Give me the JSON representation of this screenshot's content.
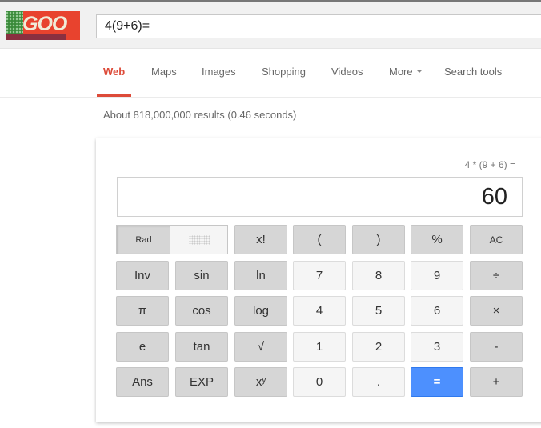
{
  "header": {
    "logo_text": "GOOGLE",
    "search_value": "4(9+6)="
  },
  "nav": {
    "tabs": [
      {
        "label": "Web",
        "active": true
      },
      {
        "label": "Maps"
      },
      {
        "label": "Images"
      },
      {
        "label": "Shopping"
      },
      {
        "label": "Videos"
      },
      {
        "label": "More",
        "dropdown": true
      },
      {
        "label": "Search tools"
      }
    ]
  },
  "stats": "About 818,000,000 results (0.46 seconds)",
  "calculator": {
    "expression": "4 * (9 + 6) =",
    "result": "60",
    "angle_mode": {
      "rad": "Rad",
      "selected": "Rad"
    },
    "rows": [
      [
        {
          "label": "x!",
          "t": "fn"
        },
        {
          "label": "(",
          "t": "fn"
        },
        {
          "label": ")",
          "t": "fn"
        },
        {
          "label": "%",
          "t": "fn"
        },
        {
          "label": "AC",
          "t": "fn small"
        }
      ],
      [
        {
          "label": "Inv",
          "t": "fn"
        },
        {
          "label": "sin",
          "t": "fn"
        },
        {
          "label": "ln",
          "t": "fn"
        },
        {
          "label": "7",
          "t": "num"
        },
        {
          "label": "8",
          "t": "num"
        },
        {
          "label": "9",
          "t": "num"
        },
        {
          "label": "÷",
          "t": "fn"
        }
      ],
      [
        {
          "label": "π",
          "t": "fn"
        },
        {
          "label": "cos",
          "t": "fn"
        },
        {
          "label": "log",
          "t": "fn"
        },
        {
          "label": "4",
          "t": "num"
        },
        {
          "label": "5",
          "t": "num"
        },
        {
          "label": "6",
          "t": "num"
        },
        {
          "label": "×",
          "t": "fn"
        }
      ],
      [
        {
          "label": "e",
          "t": "fn"
        },
        {
          "label": "tan",
          "t": "fn"
        },
        {
          "label": "√",
          "t": "fn"
        },
        {
          "label": "1",
          "t": "num"
        },
        {
          "label": "2",
          "t": "num"
        },
        {
          "label": "3",
          "t": "num"
        },
        {
          "label": "-",
          "t": "fn"
        }
      ],
      [
        {
          "label": "Ans",
          "t": "fn"
        },
        {
          "label": "EXP",
          "t": "fn"
        },
        {
          "label": "xʸ",
          "t": "fn"
        },
        {
          "label": "0",
          "t": "num"
        },
        {
          "label": ".",
          "t": "num"
        },
        {
          "label": "=",
          "t": "eq"
        },
        {
          "label": "+",
          "t": "fn"
        }
      ]
    ]
  }
}
